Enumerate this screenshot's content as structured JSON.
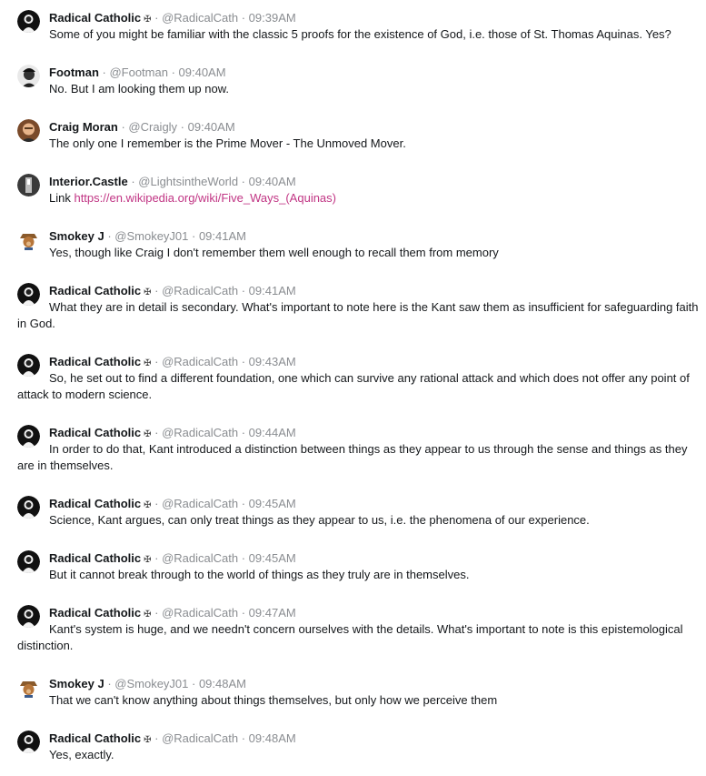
{
  "messages": [
    {
      "name": "Radical Catholic",
      "badge": "✠",
      "handle": "@RadicalCath",
      "time": "09:39AM",
      "avatar": "radical",
      "text": "Some of you might be familiar with the classic 5 proofs for the existence of God, i.e. those of St. Thomas Aquinas. Yes?"
    },
    {
      "name": "Footman",
      "badge": "",
      "handle": "@Footman",
      "time": "09:40AM",
      "avatar": "footman",
      "text": "No. But I am looking them up now."
    },
    {
      "name": "Craig Moran",
      "badge": "",
      "handle": "@Craigly",
      "time": "09:40AM",
      "avatar": "craig",
      "text": "The only one I remember is the Prime Mover - The Unmoved Mover."
    },
    {
      "name": "Interior.Castle",
      "badge": "",
      "handle": "@LightsintheWorld",
      "time": "09:40AM",
      "avatar": "castle",
      "text": "Link ",
      "link": "https://en.wikipedia.org/wiki/Five_Ways_(Aquinas)"
    },
    {
      "name": "Smokey J",
      "badge": "",
      "handle": "@SmokeyJ01",
      "time": "09:41AM",
      "avatar": "smokey",
      "text": "Yes, though like Craig I don't remember them well enough to recall them from memory"
    },
    {
      "name": "Radical Catholic",
      "badge": "✠",
      "handle": "@RadicalCath",
      "time": "09:41AM",
      "avatar": "radical",
      "text": "What they are in detail is secondary. What's important to note here is the Kant saw them as insufficient for safeguarding faith in God."
    },
    {
      "name": "Radical Catholic",
      "badge": "✠",
      "handle": "@RadicalCath",
      "time": "09:43AM",
      "avatar": "radical",
      "text": "So, he set out to find a different foundation, one which can survive any rational attack and which does not offer any point of attack to modern science."
    },
    {
      "name": "Radical Catholic",
      "badge": "✠",
      "handle": "@RadicalCath",
      "time": "09:44AM",
      "avatar": "radical",
      "text": "In order to do that, Kant introduced a distinction between things as they appear to us through the sense and things as they are in themselves."
    },
    {
      "name": "Radical Catholic",
      "badge": "✠",
      "handle": "@RadicalCath",
      "time": "09:45AM",
      "avatar": "radical",
      "text": "Science, Kant argues, can only treat things as they appear to us, i.e. the phenomena of our experience."
    },
    {
      "name": "Radical Catholic",
      "badge": "✠",
      "handle": "@RadicalCath",
      "time": "09:45AM",
      "avatar": "radical",
      "text": "But it cannot break through to the world of things as they truly are in themselves."
    },
    {
      "name": "Radical Catholic",
      "badge": "✠",
      "handle": "@RadicalCath",
      "time": "09:47AM",
      "avatar": "radical",
      "text": "Kant's system is huge, and we needn't concern ourselves with the details. What's important to note is this epistemological distinction."
    },
    {
      "name": "Smokey J",
      "badge": "",
      "handle": "@SmokeyJ01",
      "time": "09:48AM",
      "avatar": "smokey",
      "text": "That we can't know anything about things themselves, but only how we perceive them"
    },
    {
      "name": "Radical Catholic",
      "badge": "✠",
      "handle": "@RadicalCath",
      "time": "09:48AM",
      "avatar": "radical",
      "text": "Yes, exactly."
    }
  ]
}
